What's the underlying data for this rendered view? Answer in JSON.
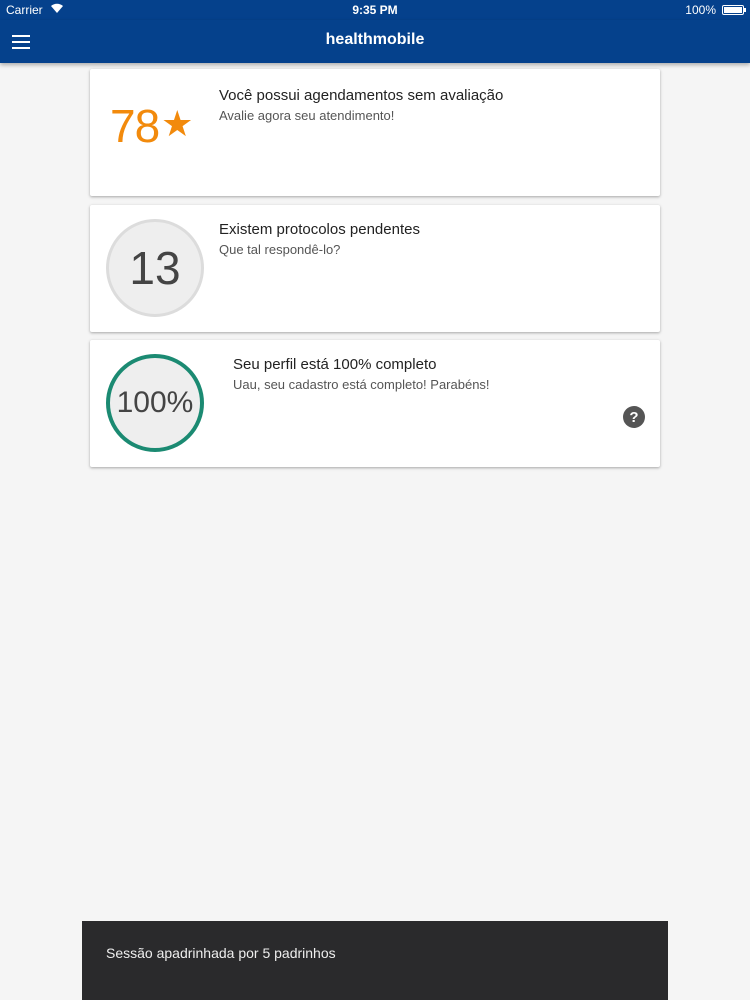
{
  "status_bar": {
    "carrier": "Carrier",
    "wifi_icon": "wifi-icon",
    "time": "9:35 PM",
    "battery": "100%"
  },
  "app_bar": {
    "menu_icon": "hamburger-menu-icon",
    "title": "healthmobile"
  },
  "cards": {
    "rating": {
      "value": "78",
      "star": "★",
      "title": "Você possui agendamentos sem avaliação",
      "subtitle": "Avalie agora seu atendimento!"
    },
    "protocols": {
      "count": "13",
      "title": "Existem protocolos pendentes",
      "subtitle": "Que tal respondê-lo?"
    },
    "profile": {
      "percent": "100%",
      "progress_fraction": 1.0,
      "title": "Seu perfil está 100% completo",
      "subtitle": "Uau, seu cadastro está completo! Parabéns!",
      "help_icon": "?"
    }
  },
  "snackbar": {
    "text": "Sessão apadrinhada por 5 padrinhos"
  },
  "colors": {
    "primary": "#05418c",
    "rating_accent": "#f28a0c",
    "progress_ring": "#1b8a72",
    "snackbar_bg": "#2a2a2c"
  }
}
